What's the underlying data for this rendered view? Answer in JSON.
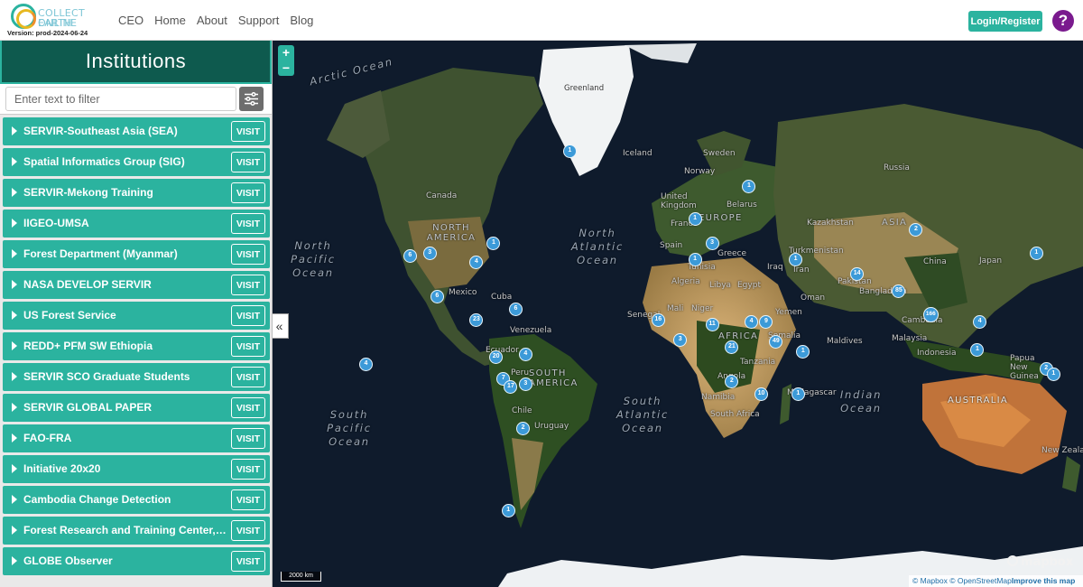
{
  "header": {
    "logo_line1": "COLLECT EARTH",
    "logo_line2": "ONLINE",
    "version": "Version: prod-2024-06-24",
    "nav": [
      "CEO",
      "Home",
      "About",
      "Support",
      "Blog"
    ],
    "login_label": "Login/Register",
    "help_label": "?"
  },
  "sidebar": {
    "title": "Institutions",
    "filter_placeholder": "Enter text to filter",
    "visit_label": "VISIT",
    "institutions": [
      "SERVIR-Southeast Asia (SEA)",
      "Spatial Informatics Group (SIG)",
      "SERVIR-Mekong Training",
      "IIGEO-UMSA",
      "Forest Department (Myanmar)",
      "NASA DEVELOP SERVIR",
      "US Forest Service",
      "REDD+ PFM SW Ethiopia",
      "SERVIR SCO Graduate Students",
      "SERVIR GLOBAL PAPER",
      "FAO-FRA",
      "Initiative 20x20",
      "Cambodia Change Detection",
      "Forest Research and Training Center, Ne...",
      "GLOBE Observer"
    ]
  },
  "map": {
    "collapse_icon": "«",
    "zoom_in": "+",
    "zoom_out": "−",
    "scale_label": "2000 km",
    "mapbox_label": "mapbox",
    "attribution": {
      "mapbox": "© Mapbox",
      "osm": "© OpenStreetMap",
      "improve": "Improve this map"
    },
    "labels": {
      "arctic_ocean": "Arctic Ocean",
      "greenland": "Greenland",
      "iceland": "Iceland",
      "norway": "Norway",
      "sweden": "Sweden",
      "russia": "Russia",
      "canada": "Canada",
      "united_kingdom": "United Kingdom",
      "belarus": "Belarus",
      "france": "France",
      "europe": "EUROPE",
      "kazakhstan": "Kazakhstan",
      "asia": "ASIA",
      "north_america": "NORTH AMERICA",
      "north_atlantic": "North Atlantic Ocean",
      "north_pacific": "North Pacific Ocean",
      "spain": "Spain",
      "greece": "Greece",
      "turkmenistan": "Turkmenistan",
      "china": "China",
      "japan": "Japan",
      "tunisia": "Tunisia",
      "iraq": "Iraq",
      "iran": "Iran",
      "pakistan": "Pakistan",
      "algeria": "Algeria",
      "libya": "Libya",
      "egypt": "Egypt",
      "oman": "Oman",
      "bangladesh": "Bangladesh",
      "cuba": "Cuba",
      "mexico": "Mexico",
      "mali": "Mali",
      "niger": "Niger",
      "senegal": "Senegal",
      "yemen": "Yemen",
      "cambodia": "Cambodia",
      "venezuela": "Venezuela",
      "africa": "AFRICA",
      "somalia": "Somalia",
      "maldives": "Maldives",
      "malaysia": "Malaysia",
      "ecuador": "Ecuador",
      "indonesia": "Indonesia",
      "papua": "Papua New Guinea",
      "peru": "Peru",
      "south_america": "SOUTH AMERICA",
      "tanzania": "Tanzania",
      "angola": "Angola",
      "namibia": "Namibia",
      "madagascar": "Madagascar",
      "indian_ocean": "Indian Ocean",
      "australia": "AUSTRALIA",
      "chile": "Chile",
      "uruguay": "Uruguay",
      "south_africa": "South Africa",
      "south_pacific": "South Pacific Ocean",
      "south_atlantic": "South Atlantic Ocean",
      "new_zealand": "New Zealand"
    },
    "markers": [
      {
        "count": "1",
        "lon": -49,
        "lat": 64
      },
      {
        "count": "1",
        "lon": 24,
        "lat": 57
      },
      {
        "count": "2",
        "lon": 92,
        "lat": 46
      },
      {
        "count": "1",
        "lon": 141,
        "lat": 39
      },
      {
        "count": "1",
        "lon": 2,
        "lat": 49
      },
      {
        "count": "3",
        "lon": 9,
        "lat": 42
      },
      {
        "count": "1",
        "lon": 2,
        "lat": 37
      },
      {
        "count": "1",
        "lon": 43,
        "lat": 37
      },
      {
        "count": "14",
        "lon": 68,
        "lat": 32
      },
      {
        "count": "85",
        "lon": 85,
        "lat": 26
      },
      {
        "count": "166",
        "lon": 98,
        "lat": 17
      },
      {
        "count": "4",
        "lon": 118,
        "lat": 14
      },
      {
        "count": "1",
        "lon": 117,
        "lat": 3
      },
      {
        "count": "2",
        "lon": 145,
        "lat": -5
      },
      {
        "count": "1",
        "lon": 148,
        "lat": -7
      },
      {
        "count": "1",
        "lon": -80,
        "lat": 42
      },
      {
        "count": "6",
        "lon": -114,
        "lat": 38
      },
      {
        "count": "3",
        "lon": -106,
        "lat": 39
      },
      {
        "count": "4",
        "lon": -87,
        "lat": 36
      },
      {
        "count": "6",
        "lon": -103,
        "lat": 24
      },
      {
        "count": "6",
        "lon": -71,
        "lat": 19
      },
      {
        "count": "23",
        "lon": -87,
        "lat": 15
      },
      {
        "count": "4",
        "lon": -132,
        "lat": -3
      },
      {
        "count": "20",
        "lon": -79,
        "lat": 0
      },
      {
        "count": "4",
        "lon": -67,
        "lat": 1
      },
      {
        "count": "7",
        "lon": -76,
        "lat": -9
      },
      {
        "count": "17",
        "lon": -73,
        "lat": -12
      },
      {
        "count": "3",
        "lon": -67,
        "lat": -11
      },
      {
        "count": "2",
        "lon": -68,
        "lat": -28
      },
      {
        "count": "1",
        "lon": -74,
        "lat": -53
      },
      {
        "count": "16",
        "lon": -13,
        "lat": 15
      },
      {
        "count": "3",
        "lon": -4,
        "lat": 7
      },
      {
        "count": "11",
        "lon": 9,
        "lat": 13
      },
      {
        "count": "4",
        "lon": 25,
        "lat": 14
      },
      {
        "count": "9",
        "lon": 31,
        "lat": 14
      },
      {
        "count": "21",
        "lon": 17,
        "lat": 4
      },
      {
        "count": "49",
        "lon": 35,
        "lat": 6
      },
      {
        "count": "1",
        "lon": 46,
        "lat": 2
      },
      {
        "count": "2",
        "lon": 17,
        "lat": -10
      },
      {
        "count": "10",
        "lon": 29,
        "lat": -15
      },
      {
        "count": "1",
        "lon": 44,
        "lat": -15
      }
    ]
  }
}
